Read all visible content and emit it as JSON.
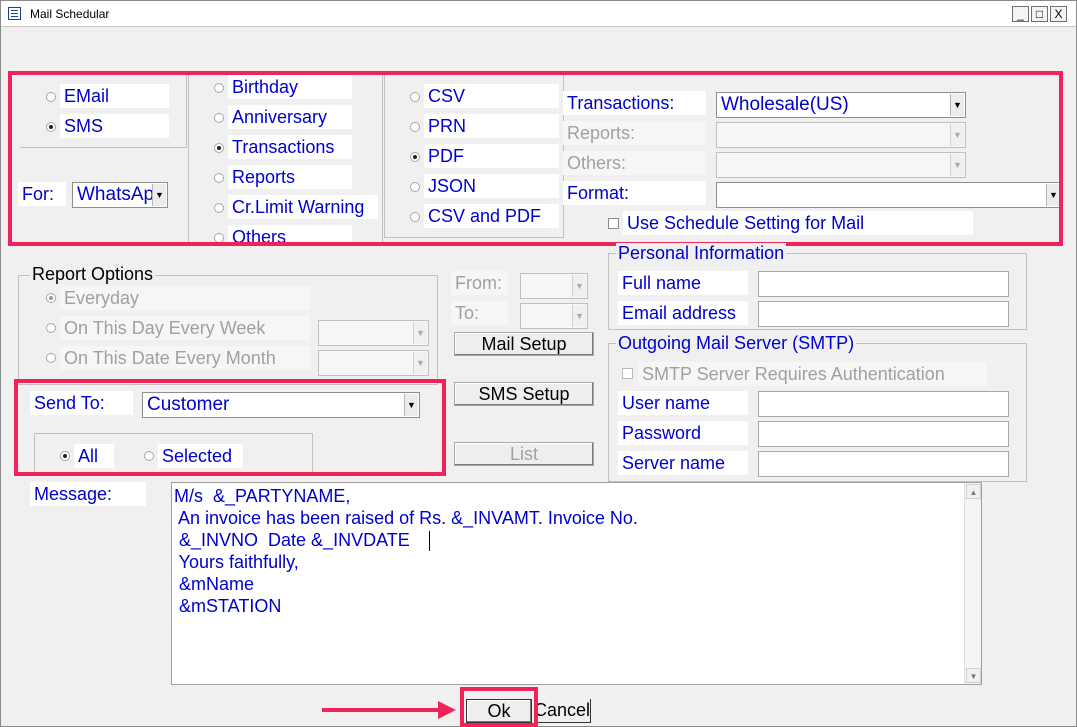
{
  "window": {
    "title": "Mail Schedular",
    "controls": [
      "_",
      "□",
      "X"
    ]
  },
  "mode": {
    "email_label": "EMail",
    "sms_label": "SMS",
    "selected": "SMS",
    "for_label": "For:",
    "for_value": "WhatsAp"
  },
  "categories": {
    "items": [
      "Birthday",
      "Anniversary",
      "Transactions",
      "Reports",
      "Cr.Limit Warning",
      "Others"
    ],
    "selected": "Transactions"
  },
  "formats": {
    "items": [
      "CSV",
      "PRN",
      "PDF",
      "JSON",
      "CSV and PDF"
    ],
    "selected": "PDF"
  },
  "selectors": {
    "transactions_label": "Transactions:",
    "transactions_value": "Wholesale(US)",
    "reports_label": "Reports:",
    "others_label": "Others:",
    "format_label": "Format:",
    "use_schedule_label": "Use Schedule Setting for Mail"
  },
  "report_options": {
    "title": "Report Options",
    "everyday": "Everyday",
    "on_day": "On This Day Every Week",
    "on_date": "On This Date Every Month",
    "from_label": "From:",
    "to_label": "To:"
  },
  "send_to": {
    "label": "Send To:",
    "value": "Customer",
    "all_label": "All",
    "selected_label": "Selected"
  },
  "buttons": {
    "mail_setup": "Mail Setup",
    "sms_setup": "SMS Setup",
    "list": "List",
    "ok": "Ok",
    "cancel": "Cancel"
  },
  "personal_info": {
    "title": "Personal Information",
    "full_name": "Full name",
    "email_address": "Email address"
  },
  "smtp": {
    "title": "Outgoing Mail Server (SMTP)",
    "auth_label": "SMTP Server Requires Authentication",
    "user_name": "User name",
    "password": "Password",
    "server_name": "Server name"
  },
  "message": {
    "label": "Message:",
    "lines": [
      "M/s  &_PARTYNAME,",
      " An invoice has been raised of Rs. &_INVAMT. Invoice No.",
      " &_INVNO  Date &_INVDATE ",
      " Yours faithfully,",
      " &mName",
      " &mSTATION"
    ]
  },
  "colors": {
    "accent": "#f0245a",
    "text_blue": "#0000cc",
    "disabled_gray": "#a0a0a0"
  }
}
